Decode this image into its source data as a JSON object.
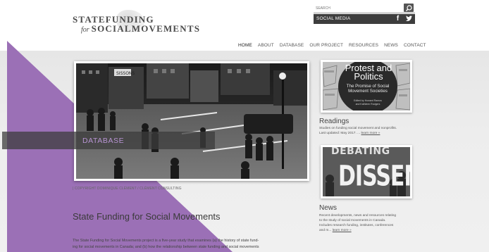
{
  "header": {
    "logo_line1": "STATEFUNDING",
    "logo_for": "for",
    "logo_line2": "SOCIALMOVEMENTS",
    "search_placeholder": "SEARCH",
    "social_label": "SOCIAL MEDIA",
    "facebook_glyph": "f"
  },
  "nav": {
    "items": [
      "HOME",
      "ABOUT",
      "DATABASE",
      "OUR PROJECT",
      "RESOURCES",
      "NEWS",
      "CONTACT"
    ]
  },
  "hero": {
    "label": "DATABASE",
    "copyright": "| COPYRIGHT DOMINIQUE CLÉMENT / CLÉMENT CONSULTING",
    "sign_text": "SISSONS"
  },
  "main": {
    "title": "State Funding for Social Movements",
    "text_line1": "The State Funding for Social Movements project is a five-year study that examines (a) the history of state fund-",
    "text_line2": "ing for social movements in Canada; and (b) how the relationship between state funding and social movements"
  },
  "readings": {
    "book_title": "Protest and Politics",
    "book_subtitle": "The Promise of Social Movement Societies",
    "book_editors_1": "Edited by Howard Ramos",
    "book_editors_2": "and Kathleen Rodgers",
    "heading": "Readings",
    "text": "Studies on funding social movement and nonprofits.",
    "updated": "Last updated: May 2017. ...",
    "learn_more": "learn more »"
  },
  "news": {
    "image_top": "DEBATING",
    "image_word": "DISSENT",
    "heading": "News",
    "line1": "Recent developments, news and resources relating",
    "line2": "to the study of social movements in Canada.",
    "line3": "Includes research funding, institutes, conferences",
    "line4": "and m...",
    "learn_more": "learn more »"
  },
  "colors": {
    "purple": "#9b70b6",
    "dark_bar": "#3d3d3d",
    "hero_label": "#b894d3"
  }
}
